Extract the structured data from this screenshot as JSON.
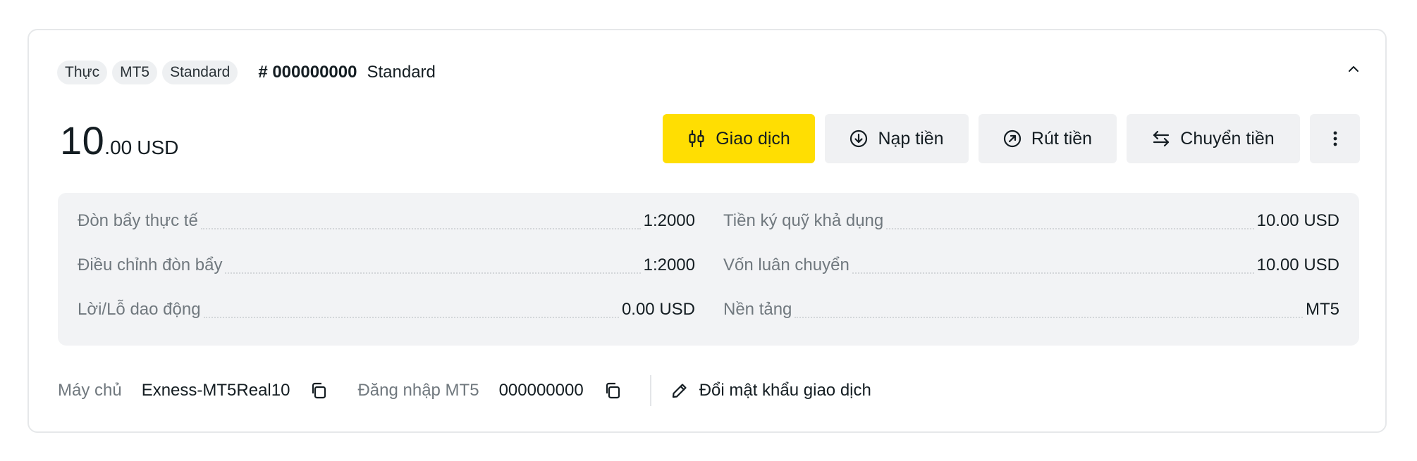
{
  "account": {
    "tags": [
      "Thực",
      "MT5",
      "Standard"
    ],
    "number": "# 000000000",
    "type": "Standard"
  },
  "balance": {
    "integer": "10",
    "decimal": ".00",
    "currency": "USD"
  },
  "actions": {
    "trade": "Giao dịch",
    "deposit": "Nạp tiền",
    "withdraw": "Rút tiền",
    "transfer": "Chuyển tiền"
  },
  "details_left": [
    {
      "label": "Đòn bẩy thực tế",
      "value": "1:2000"
    },
    {
      "label": "Điều chỉnh đòn bẩy",
      "value": "1:2000"
    },
    {
      "label": "Lời/Lỗ dao động",
      "value": "0.00 USD"
    }
  ],
  "details_right": [
    {
      "label": "Tiền ký quỹ khả dụng",
      "value": "10.00 USD"
    },
    {
      "label": "Vốn luân chuyển",
      "value": "10.00 USD"
    },
    {
      "label": "Nền tảng",
      "value": "MT5"
    }
  ],
  "footer": {
    "server_label": "Máy chủ",
    "server_value": "Exness-MT5Real10",
    "login_label": "Đăng nhập MT5",
    "login_value": "000000000",
    "change_password": "Đổi mật khẩu giao dịch"
  },
  "icons": {
    "collapse": "chevron-up-icon",
    "trade": "candlestick-icon",
    "deposit": "arrow-down-circle-icon",
    "withdraw": "arrow-up-right-circle-icon",
    "transfer": "swap-arrows-icon",
    "more": "more-vertical-icon",
    "copy": "copy-icon",
    "edit": "pencil-icon"
  },
  "colors": {
    "accent": "#ffde02",
    "panel": "#f2f3f5",
    "muted": "#70787e",
    "text": "#141d22"
  }
}
